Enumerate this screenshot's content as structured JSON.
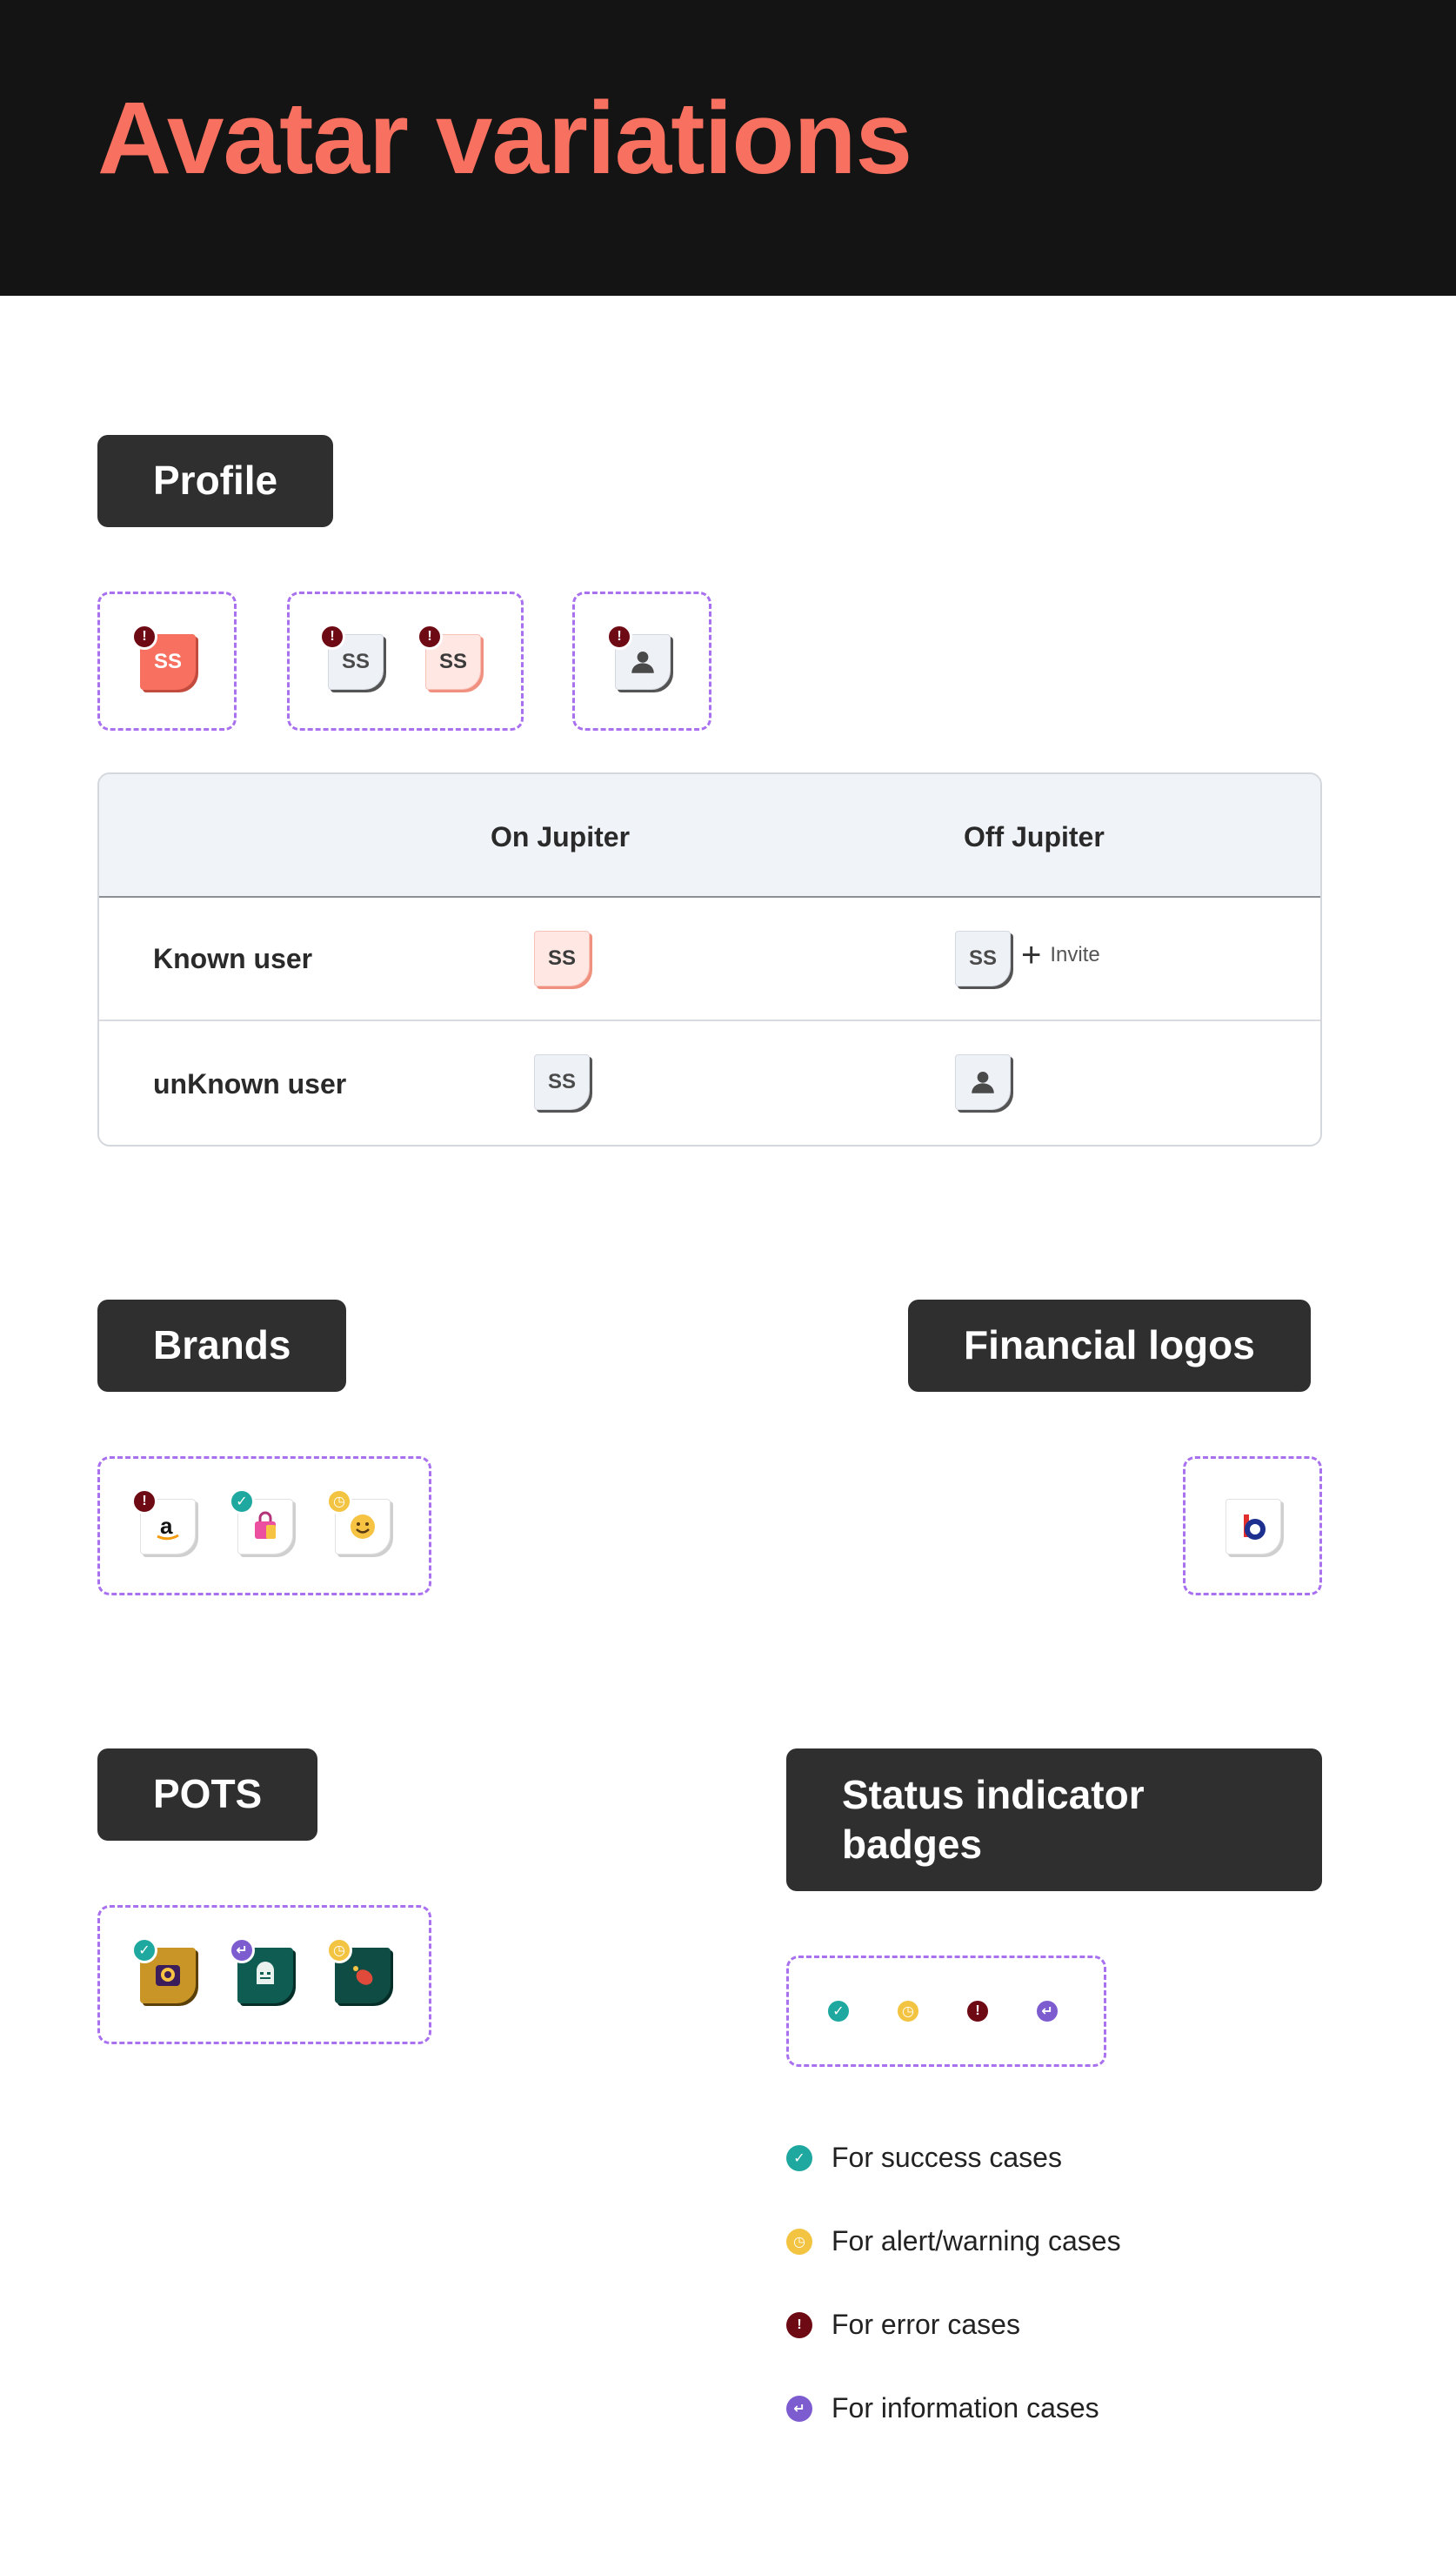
{
  "page_title": "Avatar variations",
  "sections": {
    "profile": "Profile",
    "brands": "Brands",
    "financial_logos": "Financial logos",
    "pots": "POTS",
    "status_badges": "Status indicator badges"
  },
  "avatar_initials": "SS",
  "table": {
    "col1": "On Jupiter",
    "col2": "Off Jupiter",
    "row1": "Known user",
    "row2": "unKnown user",
    "invite": "Invite"
  },
  "legend": [
    {
      "label": "For success cases",
      "icon": "check-icon",
      "color": "#1fa89f"
    },
    {
      "label": "For alert/warning cases",
      "icon": "clock-icon",
      "color": "#f3c342"
    },
    {
      "label": "For error cases",
      "icon": "exclamation-icon",
      "color": "#6e0a14"
    },
    {
      "label": "For information cases",
      "icon": "return-arrow-icon",
      "color": "#7d5cd0"
    }
  ],
  "colors": {
    "accent": "#f87060",
    "header_bg": "#141414",
    "label_bg": "#2f2f2f",
    "dashed_border": "#a970f0"
  }
}
